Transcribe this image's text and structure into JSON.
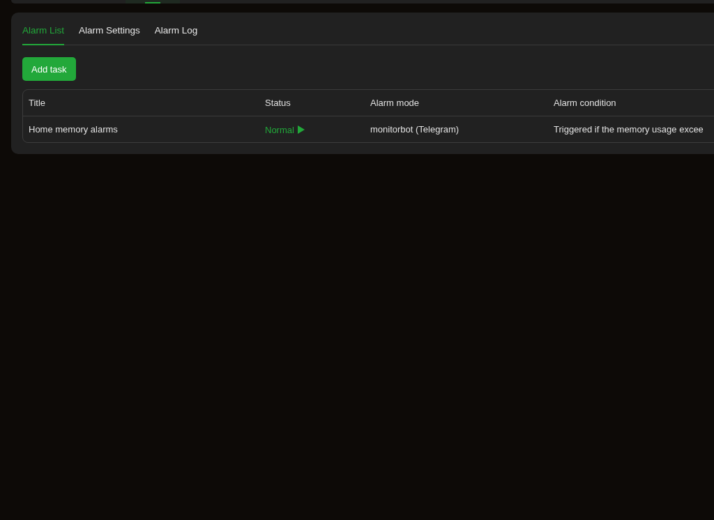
{
  "top_bar": {
    "tab_indicator": {
      "selected": true
    }
  },
  "tabs": [
    {
      "label": "Alarm List",
      "selected": true
    },
    {
      "label": "Alarm Settings",
      "selected": false
    },
    {
      "label": "Alarm Log",
      "selected": false
    }
  ],
  "add_button": "Add task",
  "table": {
    "columns": [
      "Title",
      "Status",
      "Alarm mode",
      "Alarm condition"
    ],
    "rows": [
      {
        "title": "Home memory alarms",
        "status": "Normal",
        "running": true,
        "mode": "monitorbot (Telegram)",
        "condition": "Triggered if the memory usage excee"
      }
    ]
  }
}
